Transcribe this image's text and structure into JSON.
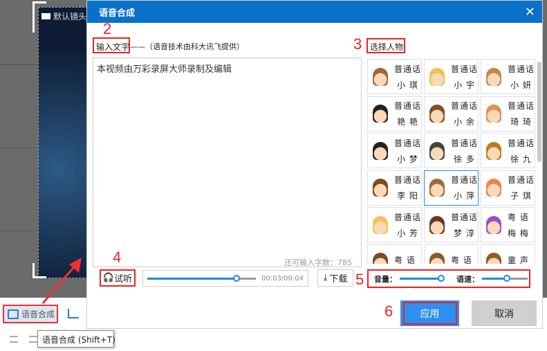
{
  "background": {
    "camera_label": "默认镜头"
  },
  "toolbar": {
    "tts_label": "语音合成",
    "tooltip": "语音合成 (Shift+T)"
  },
  "dialog": {
    "title": "语音合成",
    "close": "✕",
    "input_label": "输入文字",
    "provider_note": "——（语音技术由科大讯飞提供）",
    "text_value": "本视频由万彩录屏大师录制及编辑",
    "remaining": "还可输入字数：785",
    "voice_label": "选择人物",
    "listen_label": "试听",
    "time": "00:03/00:04",
    "playback_progress": 0.82,
    "download_label": "下载",
    "volume_label": "音量：",
    "volume": 1.0,
    "speed_label": "语速：",
    "speed": 0.55,
    "apply_label": "应用",
    "cancel_label": "取消",
    "selected_voice": "小萍",
    "voices": [
      {
        "lang": "普通话",
        "name": "小 琪",
        "color": "#a0683a"
      },
      {
        "lang": "普通话",
        "name": "小 宇",
        "color": "#f0c050"
      },
      {
        "lang": "普通话",
        "name": "小 妍",
        "color": "#c08a4a"
      },
      {
        "lang": "普通话",
        "name": "艳 艳",
        "color": "#222222"
      },
      {
        "lang": "普通话",
        "name": "小 余",
        "color": "#8a4a2a"
      },
      {
        "lang": "普通话",
        "name": "琦 琦",
        "color": "#e0905a"
      },
      {
        "lang": "普通话",
        "name": "小 梦",
        "color": "#222222"
      },
      {
        "lang": "普通话",
        "name": "徐 多",
        "color": "#444444"
      },
      {
        "lang": "普通话",
        "name": "徐 九",
        "color": "#c07a20"
      },
      {
        "lang": "普通话",
        "name": "李 阳",
        "color": "#7a4a20"
      },
      {
        "lang": "普通话",
        "name": "小 萍",
        "color": "#a06a3a"
      },
      {
        "lang": "普通话",
        "name": "子 琪",
        "color": "#f0804a"
      },
      {
        "lang": "普通话",
        "name": "小 芳",
        "color": "#f8c050"
      },
      {
        "lang": "普通话",
        "name": "梦 淳",
        "color": "#6a3a20"
      },
      {
        "lang": "粤 语",
        "name": "梅 梅",
        "color": "#9a50c0"
      },
      {
        "lang": "粤 语",
        "name": "",
        "color": "#7a4a2a"
      },
      {
        "lang": "粤 语",
        "name": "",
        "color": "#8a5a2a"
      },
      {
        "lang": "童 声",
        "name": "",
        "color": "#9a5a2a"
      }
    ]
  },
  "annotations": [
    "2",
    "3",
    "4",
    "5",
    "6"
  ],
  "colors": {
    "accent": "#0a70c8",
    "button": "#2d8ff0",
    "annotation": "#f02020"
  }
}
